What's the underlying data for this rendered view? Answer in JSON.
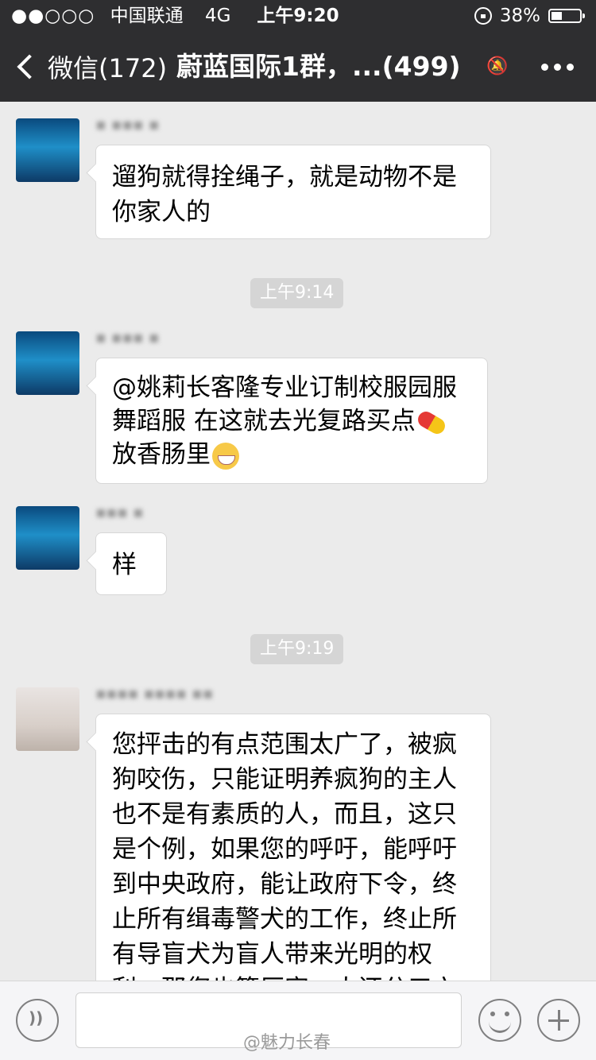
{
  "status_bar": {
    "signal": "●●○○○",
    "carrier": "中国联通",
    "network": "4G",
    "time": "上午9:20",
    "battery": "38%",
    "battery_level": 0.38
  },
  "nav": {
    "back_label": "微信(172)",
    "title": "蔚蓝国际1群，...(499)"
  },
  "messages": [
    {
      "avatar": "shark-avatar",
      "sender": "▪ ▪▪▪ ▪",
      "lines": [
        "遛狗就得拴绳子，就是动物不是",
        "你家人的"
      ]
    },
    {
      "time": "上午9:14"
    },
    {
      "avatar": "shark-avatar",
      "sender": "▪ ▪▪▪ ▪",
      "lines": [
        "@姚莉长客隆专业订制校服园服",
        "舞蹈服 在这就去光复路买点",
        "放香肠里"
      ]
    },
    {
      "avatar": "shark-avatar",
      "sender": "▪▪▪ ▪",
      "lines": [
        "样"
      ]
    },
    {
      "time": "上午9:19"
    },
    {
      "avatar": "person-avatar",
      "sender": "▪▪▪▪ ▪▪▪▪ ▪▪",
      "lines": [
        "您抨击的有点范围太广了，被疯",
        "狗咬伤，只能证明养疯狗的主人",
        "也不是有素质的人，而且，这只",
        "是个例，如果您的呼吁，能呼吁",
        "到中央政府，能让政府下令，终",
        "止所有缉毒警犬的工作，终止所",
        "有导盲犬为盲人带来光明的权",
        "利，那您也算厉害，人还分三六"
      ]
    }
  ],
  "input_bar": {
    "watermark": "@魅力长春"
  }
}
